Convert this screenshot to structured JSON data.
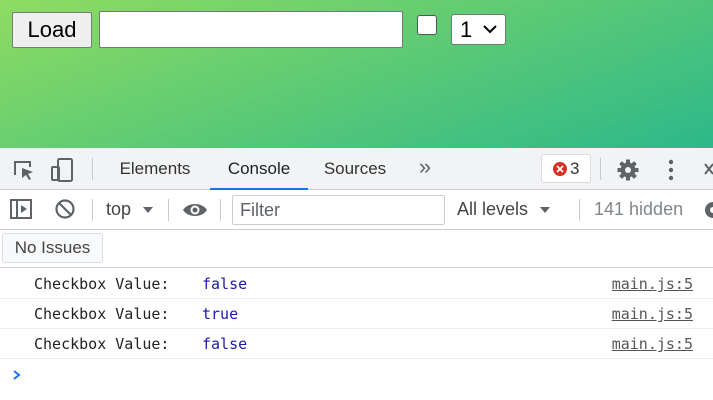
{
  "page": {
    "load_label": "Load",
    "input_value": "",
    "input_placeholder": "",
    "checkbox_checked": false,
    "select_value": "1"
  },
  "devtools": {
    "tabs": [
      {
        "label": "Elements",
        "active": false
      },
      {
        "label": "Console",
        "active": true
      },
      {
        "label": "Sources",
        "active": false
      }
    ],
    "more_tabs_glyph": "»",
    "error_count": "3",
    "icons": [
      "inspect-icon",
      "device-toggle-icon",
      "error-icon",
      "gear-icon",
      "more-vert-icon",
      "close-icon",
      "sidebar-toggle-icon",
      "clear-console-icon",
      "eye-icon",
      "chevron-down-icon",
      "prompt-chevron-icon"
    ],
    "toolbar": {
      "context": "top",
      "filter_placeholder": "Filter",
      "levels": "All levels",
      "hidden": "141 hidden"
    },
    "issues_label": "No Issues",
    "logs": [
      {
        "message": "Checkbox Value:",
        "value": "false",
        "source": "main.js:5"
      },
      {
        "message": "Checkbox Value:",
        "value": "true",
        "source": "main.js:5"
      },
      {
        "message": "Checkbox Value:",
        "value": "false",
        "source": "main.js:5"
      }
    ],
    "colors": {
      "accent": "#1a73e8",
      "error": "#d93025",
      "value": "#1a1aa6"
    }
  }
}
